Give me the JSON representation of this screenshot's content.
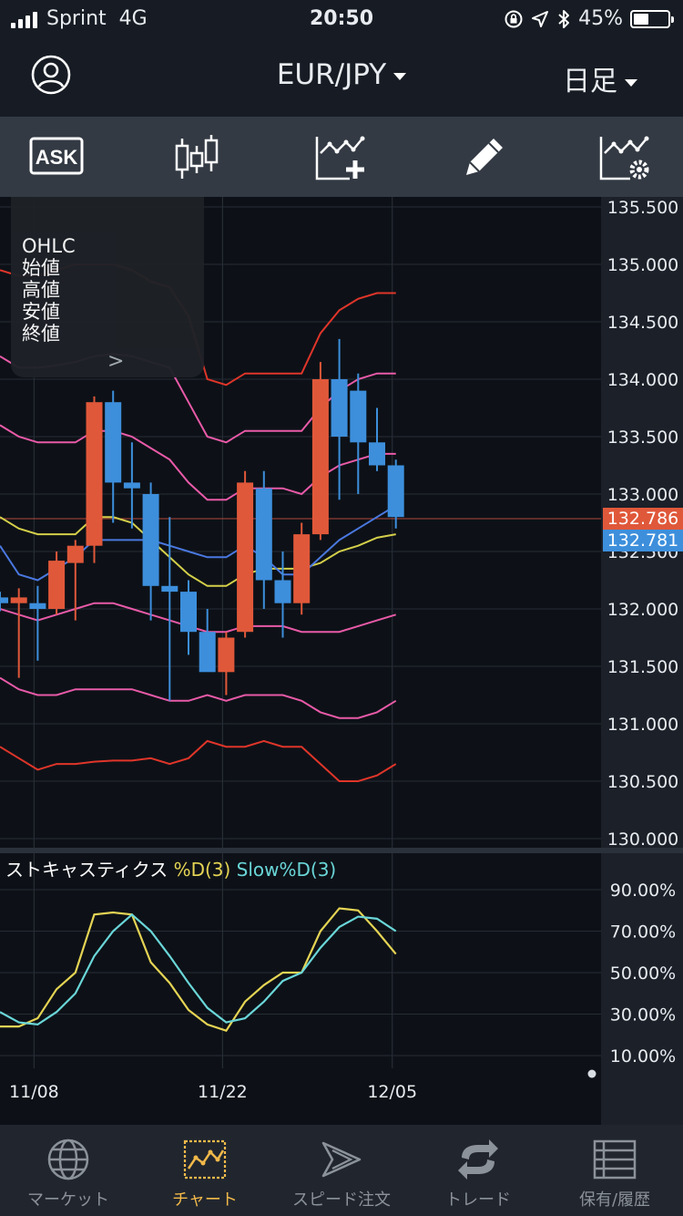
{
  "status_bar": {
    "carrier": "Sprint",
    "network": "4G",
    "time": "20:50",
    "battery": "45%",
    "battery_fraction": 0.45
  },
  "header": {
    "pair": "EUR/JPY",
    "period": "日足",
    "avatar_icon": "user-avatar-icon"
  },
  "toolbar": {
    "ask_label": "ASK",
    "icons": [
      "ask-icon",
      "candlestick-type-icon",
      "add-indicator-icon",
      "drawing-pencil-icon",
      "chart-settings-icon"
    ]
  },
  "ohlc_panel": {
    "title": "OHLC",
    "open": "始値",
    "high": "高値",
    "low": "安値",
    "close": "終値",
    "expand": ">"
  },
  "stochastic": {
    "title": "ストキャスティクス",
    "d_label": "%D(3)",
    "slow_label": "Slow%D(3)"
  },
  "price_tags": {
    "bid": "132.786",
    "ask": "132.781"
  },
  "colors": {
    "up": "#e0583a",
    "down": "#3d8fdc",
    "bb_outer": "#e0352a",
    "bb_mid": "#e85aa8",
    "ma_yellow": "#d4cf4a",
    "ma_blue": "#4a78e0",
    "stoch_yellow": "#e5d454",
    "stoch_cyan": "#6ad6d8",
    "accent": "#f2b94a"
  },
  "chart_data": [
    {
      "type": "candlestick",
      "title": "",
      "x_ticks": [
        "11/08",
        "11/22",
        "12/05"
      ],
      "ylim": [
        130.0,
        135.5
      ],
      "y_ticks": [
        "135.500",
        "135.000",
        "134.500",
        "134.000",
        "133.500",
        "133.000",
        "132.500",
        "132.000",
        "131.500",
        "131.000",
        "130.500",
        "130.000"
      ],
      "candles": [
        {
          "o": 132.1,
          "h": 132.15,
          "l": 131.98,
          "c": 132.05
        },
        {
          "o": 132.05,
          "h": 132.18,
          "l": 131.4,
          "c": 132.1
        },
        {
          "o": 132.05,
          "h": 132.2,
          "l": 131.55,
          "c": 132.0
        },
        {
          "o": 132.0,
          "h": 132.5,
          "l": 131.95,
          "c": 132.42
        },
        {
          "o": 132.4,
          "h": 132.6,
          "l": 131.9,
          "c": 132.55
        },
        {
          "o": 132.55,
          "h": 133.85,
          "l": 132.4,
          "c": 133.8
        },
        {
          "o": 133.8,
          "h": 133.9,
          "l": 132.75,
          "c": 133.1
        },
        {
          "o": 133.1,
          "h": 133.45,
          "l": 132.7,
          "c": 133.05
        },
        {
          "o": 133.0,
          "h": 133.1,
          "l": 131.9,
          "c": 132.2
        },
        {
          "o": 132.2,
          "h": 132.8,
          "l": 131.2,
          "c": 132.15
        },
        {
          "o": 132.15,
          "h": 132.25,
          "l": 131.6,
          "c": 131.8
        },
        {
          "o": 131.8,
          "h": 132.0,
          "l": 131.5,
          "c": 131.45
        },
        {
          "o": 131.45,
          "h": 131.8,
          "l": 131.25,
          "c": 131.75
        },
        {
          "o": 131.8,
          "h": 133.2,
          "l": 131.75,
          "c": 133.1
        },
        {
          "o": 133.05,
          "h": 133.2,
          "l": 132.0,
          "c": 132.25
        },
        {
          "o": 132.25,
          "h": 132.5,
          "l": 131.75,
          "c": 132.05
        },
        {
          "o": 132.05,
          "h": 132.75,
          "l": 131.95,
          "c": 132.65
        },
        {
          "o": 132.65,
          "h": 134.15,
          "l": 132.6,
          "c": 134.0
        },
        {
          "o": 134.0,
          "h": 134.35,
          "l": 132.95,
          "c": 133.5
        },
        {
          "o": 133.9,
          "h": 134.05,
          "l": 133.0,
          "c": 133.45
        },
        {
          "o": 133.45,
          "h": 133.75,
          "l": 133.2,
          "c": 133.25
        },
        {
          "o": 133.25,
          "h": 133.3,
          "l": 132.7,
          "c": 132.8
        }
      ],
      "overlays": [
        {
          "color": "bb_outer",
          "values": [
            134.95,
            134.9,
            134.9,
            134.95,
            135.0,
            135.0,
            135.0,
            134.95,
            134.85,
            134.8,
            134.55,
            134.0,
            133.95,
            134.05,
            134.05,
            134.05,
            134.05,
            134.4,
            134.6,
            134.7,
            134.75,
            134.75
          ]
        },
        {
          "color": "bb_mid",
          "values": [
            134.2,
            134.1,
            134.1,
            134.12,
            134.15,
            134.2,
            134.22,
            134.2,
            134.15,
            134.1,
            133.8,
            133.5,
            133.45,
            133.55,
            133.55,
            133.55,
            133.55,
            133.75,
            133.9,
            134.0,
            134.05,
            134.05
          ]
        },
        {
          "color": "bb_mid",
          "values": [
            133.6,
            133.5,
            133.45,
            133.45,
            133.45,
            133.55,
            133.55,
            133.5,
            133.4,
            133.3,
            133.1,
            132.95,
            132.95,
            133.05,
            133.05,
            133.05,
            133.0,
            133.15,
            133.25,
            133.3,
            133.35,
            133.35
          ]
        },
        {
          "color": "ma_yellow",
          "values": [
            132.8,
            132.7,
            132.65,
            132.65,
            132.65,
            132.8,
            132.8,
            132.75,
            132.6,
            132.45,
            132.3,
            132.2,
            132.2,
            132.3,
            132.35,
            132.35,
            132.35,
            132.4,
            132.5,
            132.55,
            132.62,
            132.65
          ]
        },
        {
          "color": "ma_blue",
          "values": [
            132.55,
            132.3,
            132.25,
            132.35,
            132.45,
            132.6,
            132.6,
            132.6,
            132.6,
            132.55,
            132.5,
            132.45,
            132.45,
            132.55,
            132.45,
            132.3,
            132.3,
            132.45,
            132.6,
            132.7,
            132.8,
            132.9
          ]
        },
        {
          "color": "bb_mid",
          "values": [
            132.0,
            131.95,
            131.9,
            131.95,
            132.0,
            132.05,
            132.05,
            132.0,
            131.95,
            131.9,
            131.85,
            131.8,
            131.8,
            131.85,
            131.85,
            131.85,
            131.8,
            131.8,
            131.8,
            131.85,
            131.9,
            131.95
          ]
        },
        {
          "color": "bb_mid",
          "values": [
            131.4,
            131.3,
            131.25,
            131.25,
            131.3,
            131.3,
            131.3,
            131.3,
            131.25,
            131.2,
            131.2,
            131.25,
            131.2,
            131.25,
            131.25,
            131.25,
            131.2,
            131.1,
            131.05,
            131.05,
            131.1,
            131.2
          ]
        },
        {
          "color": "bb_outer",
          "values": [
            130.8,
            130.7,
            130.6,
            130.65,
            130.65,
            130.67,
            130.68,
            130.68,
            130.7,
            130.65,
            130.7,
            130.85,
            130.8,
            130.8,
            130.85,
            130.8,
            130.8,
            130.65,
            130.5,
            130.5,
            130.55,
            130.65
          ]
        }
      ]
    },
    {
      "type": "line",
      "title": "",
      "ylim": [
        0,
        100
      ],
      "y_ticks": [
        "90.00%",
        "70.00%",
        "50.00%",
        "30.00%",
        "10.00%"
      ],
      "series": [
        {
          "name": "%D(3)",
          "color": "stoch_yellow",
          "values": [
            24,
            24,
            28,
            42,
            50,
            78,
            79,
            78,
            55,
            45,
            32,
            25,
            22,
            36,
            44,
            50,
            50,
            70,
            81,
            80,
            70,
            59
          ]
        },
        {
          "name": "Slow%D(3)",
          "color": "stoch_cyan",
          "values": [
            31,
            26,
            25,
            31,
            40,
            58,
            70,
            78,
            70,
            58,
            45,
            33,
            26,
            28,
            36,
            46,
            50,
            62,
            72,
            77,
            76,
            70
          ]
        }
      ]
    }
  ],
  "tabs": [
    {
      "label": "マーケット",
      "icon": "globe-icon",
      "active": false
    },
    {
      "label": "チャート",
      "icon": "chart-icon",
      "active": true
    },
    {
      "label": "スピード注文",
      "icon": "speed-order-icon",
      "active": false
    },
    {
      "label": "トレード",
      "icon": "trade-arrows-icon",
      "active": false
    },
    {
      "label": "保有/履歴",
      "icon": "holdings-list-icon",
      "active": false
    }
  ]
}
